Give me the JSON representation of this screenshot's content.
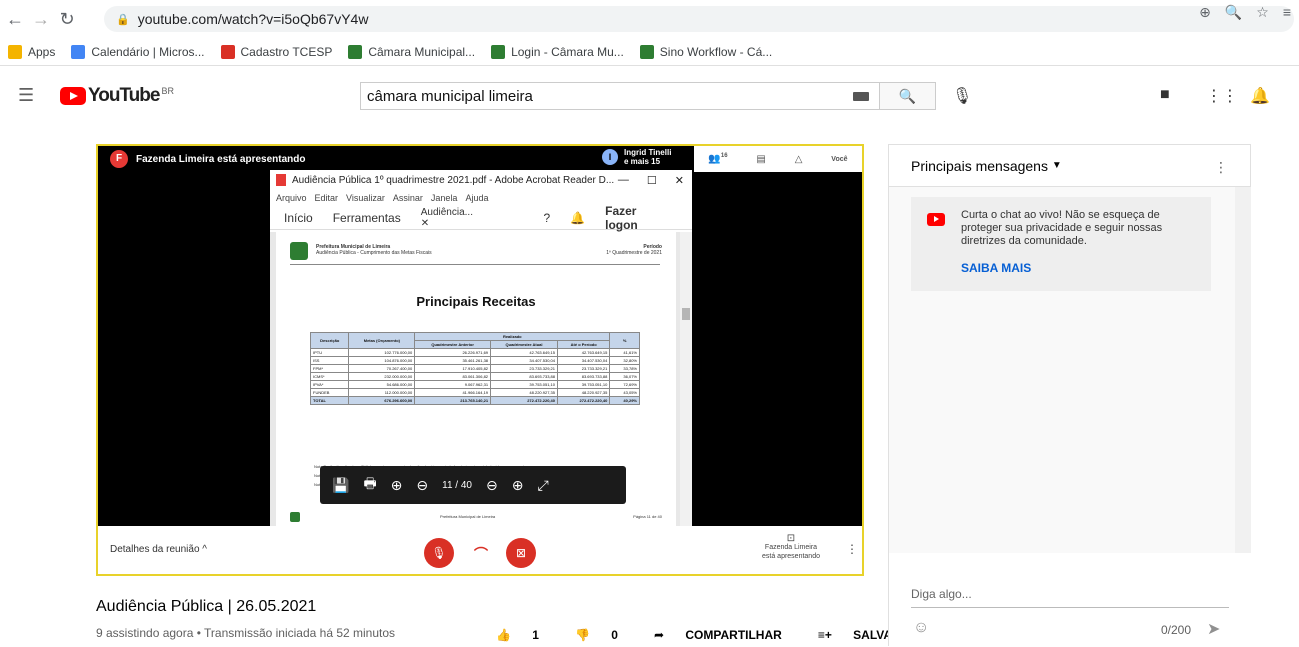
{
  "browser": {
    "url": "youtube.com/watch?v=i5oQb67vY4w",
    "bookmarks": [
      {
        "label": "Apps",
        "color": "#f4b400"
      },
      {
        "label": "Calendário | Micros...",
        "color": "#4285f4"
      },
      {
        "label": "Cadastro TCESP",
        "color": "#d93025"
      },
      {
        "label": "Câmara Municipal...",
        "color": "#2e7d32"
      },
      {
        "label": "Login - Câmara Mu...",
        "color": "#2e7d32"
      },
      {
        "label": "Sino Workflow - Cá...",
        "color": "#2e7d32"
      }
    ]
  },
  "youtube": {
    "logo": "YouTube",
    "country": "BR",
    "search_value": "câmara municipal limeira"
  },
  "meeting": {
    "presenter_text": "Fazenda Limeira está apresentando",
    "presenter_initial": "F",
    "participant_initial": "I",
    "participant_line1": "Ingrid Tinelli",
    "participant_line2": "e mais 15",
    "people_count": "16",
    "you_label": "Você",
    "details_label": "Detalhes da reunião",
    "presenting_line1": "Fazenda Limeira",
    "presenting_line2": "está apresentando"
  },
  "acrobat": {
    "window_title": "Audiência Pública 1º quadrimestre 2021.pdf - Adobe Acrobat Reader D...",
    "menu": [
      "Arquivo",
      "Editar",
      "Visualizar",
      "Assinar",
      "Janela",
      "Ajuda"
    ],
    "tabs": [
      "Início",
      "Ferramentas",
      "Audiência...",
      "Fazer logon"
    ],
    "page_number": "11",
    "page_total": "/ 40"
  },
  "document": {
    "org": "Prefeitura Municipal de Limeira",
    "subtitle": "Audiência Pública - Cumprimento das Metas Fiscais",
    "period_label": "Período",
    "period_value": "1º Quadrimestre de 2021",
    "title": "Principais Receitas",
    "headers": {
      "desc": "Descrição",
      "meta": "Metas (Orçamento)",
      "realizado": "Realizado",
      "q_ant": "Quadrimestre Anterior",
      "q_atual": "Quadrimestre Atual",
      "ate": "Até o Período",
      "pct": "%"
    },
    "rows": [
      [
        "IPTU",
        "102.776.000,00",
        "26.226.971,69",
        "42.763.649,15",
        "42.763.649,15",
        "41,61%"
      ],
      [
        "ISS",
        "104.876.000,00",
        "35.461.261,38",
        "34.407.530,04",
        "34.407.530,04",
        "32,80%"
      ],
      [
        "FPM*",
        "70.267.400,00",
        "17.910.405,82",
        "23.733.329,21",
        "23.733.329,21",
        "33,78%"
      ],
      [
        "ICMS*",
        "232.000.000,00",
        "83.061.306,82",
        "83.693.733,88",
        "83.693.733,88",
        "36,07%"
      ],
      [
        "IPVA*",
        "54.686.000,00",
        "9.067.962,31",
        "39.753.051,10",
        "39.753.051,10",
        "72,69%"
      ],
      [
        "FUNDEB",
        "112.000.000,00",
        "41.966.164,19",
        "48.220.927,35",
        "48.220.927,35",
        "43,05%"
      ]
    ],
    "total": [
      "TOTAL",
      "676.296.600,00",
      "213.765.140,21",
      "272.472.220,40",
      "272.472.220,40",
      "40,29%"
    ],
    "notes": [
      "Nota Explicativa: A coluna \"%\" demonstra o percentual realizado até o período frente à meta estabelecida no orçamento.",
      "Nota Explicativa: *FUNDEB (20%) já deduzido.",
      "Nota Explicativa: Dados consolidados exceto órgão de previdência sem fundo de previdência"
    ],
    "footer_center": "Prefeitura Municipal de Limeira",
    "footer_right": "Página 11 de 40"
  },
  "video": {
    "title": "Audiência Pública | 26.05.2021",
    "meta": "9 assistindo agora • Transmissão iniciada há 52 minutos",
    "likes": "1",
    "dislikes": "0",
    "share": "COMPARTILHAR",
    "save": "SALVAR"
  },
  "chat": {
    "header": "Principais mensagens",
    "notice": "Curta o chat ao vivo! Não se esqueça de proteger sua privacidade e seguir nossas diretrizes da comunidade.",
    "notice_link": "SAIBA MAIS",
    "placeholder": "Diga algo...",
    "counter": "0/200"
  }
}
